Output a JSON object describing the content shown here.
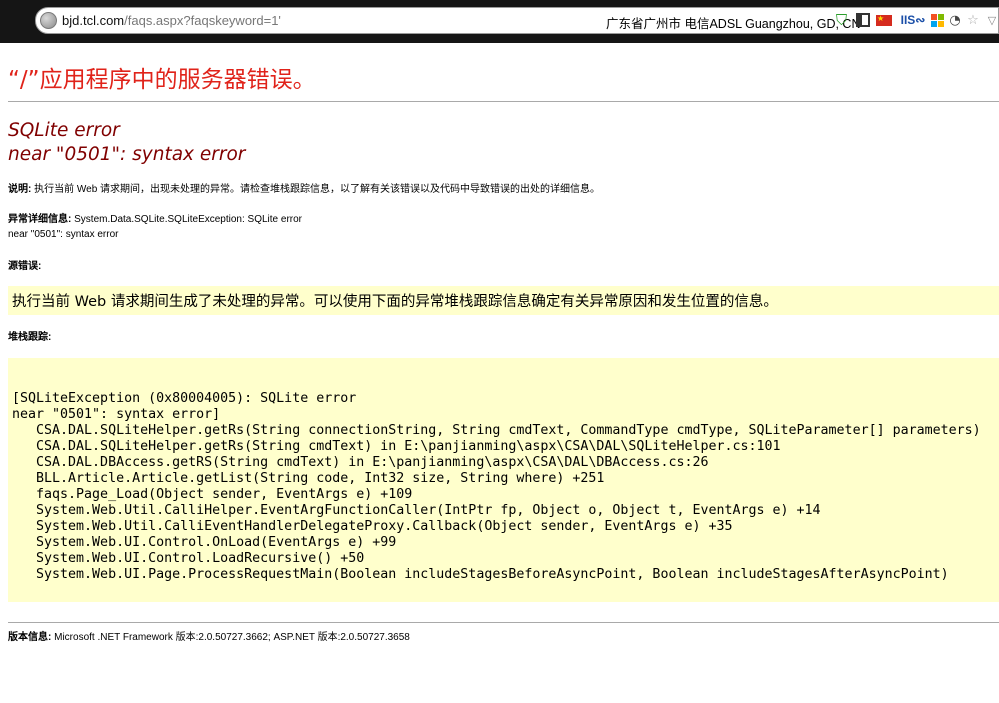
{
  "browser": {
    "url_host": "bjd.tcl.com",
    "url_path": "/faqs.aspx?faqskeyword=1'",
    "location_text": "广东省广州市 电信ADSL   Guangzhou, GD, CN",
    "iis_label": "IIS",
    "icons": [
      "globe-icon",
      "shield-icon",
      "qr-code-icon",
      "china-flag-icon",
      "iis-icon",
      "windows-icon",
      "rss-icon",
      "star-icon",
      "chevron-down-icon",
      "reload-icon"
    ],
    "colors": {
      "chrome": "#151515",
      "shield": "#2a9d2a",
      "iis": "#1b4fa8"
    }
  },
  "page": {
    "title": "“/”应用程序中的服务器错误。",
    "error_line1": "SQLite error",
    "error_line2": "near \"0501\": syntax error",
    "description_label": "说明:",
    "description_text": " 执行当前 Web 请求期间，出现未处理的异常。请检查堆栈跟踪信息，以了解有关该错误以及代码中导致错误的出处的详细信息。",
    "exception_label": "异常详细信息:",
    "exception_text1": " System.Data.SQLite.SQLiteException: SQLite error",
    "exception_text2": "near \"0501\": syntax error",
    "source_label": "源错误:",
    "source_text": "执行当前 Web 请求期间生成了未处理的异常。可以使用下面的异常堆栈跟踪信息确定有关异常原因和发生位置的信息。",
    "stack_label": "堆栈跟踪:",
    "stack_lines": [
      "[SQLiteException (0x80004005): SQLite error",
      "near \"0501\": syntax error]",
      "   CSA.DAL.SQLiteHelper.getRs(String connectionString, String cmdText, CommandType cmdType, SQLiteParameter[] parameters)",
      "   CSA.DAL.SQLiteHelper.getRs(String cmdText) in E:\\panjianming\\aspx\\CSA\\DAL\\SQLiteHelper.cs:101",
      "   CSA.DAL.DBAccess.getRS(String cmdText) in E:\\panjianming\\aspx\\CSA\\DAL\\DBAccess.cs:26",
      "   BLL.Article.Article.getList(String code, Int32 size, String where) +251",
      "   faqs.Page_Load(Object sender, EventArgs e) +109",
      "   System.Web.Util.CalliHelper.EventArgFunctionCaller(IntPtr fp, Object o, Object t, EventArgs e) +14",
      "   System.Web.Util.CalliEventHandlerDelegateProxy.Callback(Object sender, EventArgs e) +35",
      "   System.Web.UI.Control.OnLoad(EventArgs e) +99",
      "   System.Web.UI.Control.LoadRecursive() +50",
      "   System.Web.UI.Page.ProcessRequestMain(Boolean includeStagesBeforeAsyncPoint, Boolean includeStagesAfterAsyncPoint)"
    ],
    "version_label": "版本信息:",
    "version_text": " Microsoft .NET Framework 版本:2.0.50727.3662; ASP.NET 版本:2.0.50727.3658",
    "colors": {
      "title": "#e0231a",
      "error": "#800000",
      "highlight": "#ffffcc",
      "rule": "#a9a9a9"
    }
  }
}
